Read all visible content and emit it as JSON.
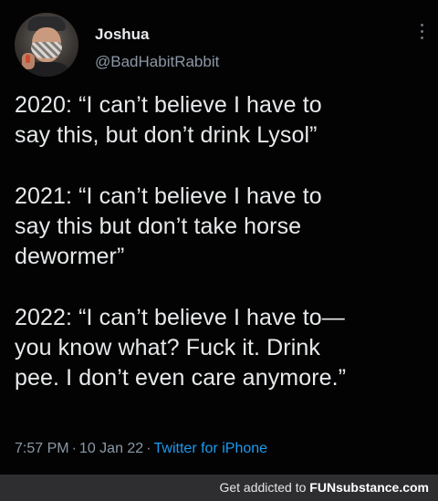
{
  "tweet": {
    "author": {
      "name": "Joshua",
      "handle": "@BadHabitRabbit"
    },
    "paragraphs": [
      "2020: “I can’t believe I have to\nsay this, but don’t drink Lysol”",
      "2021: “I can’t believe I have to\nsay this but don’t take horse\ndewormer”",
      "2022: “I can’t believe I have to—\nyou know what? Fuck it. Drink\npee. I don’t even care anymore.”"
    ],
    "time": "7:57 PM",
    "date": "10 Jan 22",
    "separator": "·",
    "source": "Twitter for iPhone"
  },
  "footer": {
    "text": "Get addicted to",
    "brand": "FUNsubstance.com"
  },
  "colors": {
    "background": "#000000",
    "text": "#e7e9ea",
    "secondary": "#8b98a5",
    "link": "#1d9bf0",
    "footer_bg": "#2e2e30"
  },
  "icons": {
    "more": "more-vertical-icon"
  }
}
